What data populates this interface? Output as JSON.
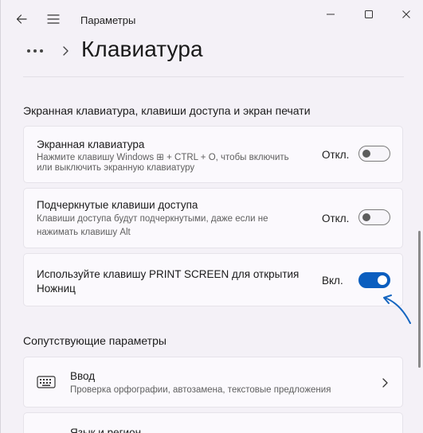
{
  "titlebar": {
    "app_title": "Параметры",
    "icons": [
      "back-arrow-icon",
      "hamburger-menu-icon",
      "minimize-icon",
      "maximize-icon",
      "close-icon"
    ]
  },
  "header": {
    "breadcrumb_more": "•••",
    "page_title": "Клавиатура"
  },
  "section1": {
    "title": "Экранная клавиатура, клавиши доступа и экран печати",
    "cards": [
      {
        "title": "Экранная клавиатура",
        "subtitle_line1": "Нажмите клавишу Windows ⊞ + CTRL + O, чтобы включить",
        "subtitle_line2": "или выключить экранную клавиатуру",
        "state": "Откл.",
        "on": false
      },
      {
        "title": "Подчеркнутые клавиши доступа",
        "subtitle_line1": "Клавиши доступа будут подчеркнутыми, даже если не",
        "subtitle_line2": "нажимать клавишу Alt",
        "state": "Откл.",
        "on": false
      },
      {
        "title_line1": "Используйте клавишу PRINT SCREEN для открытия",
        "title_line2": "Ножниц",
        "state": "Вкл.",
        "on": true
      }
    ]
  },
  "section2": {
    "title": "Сопутствующие параметры",
    "items": [
      {
        "icon": "keyboard-icon",
        "title": "Ввод",
        "subtitle": "Проверка орфографии, автозамена, текстовые предложения"
      },
      {
        "title": "Язык и регион"
      }
    ]
  },
  "colors": {
    "accent": "#0a5ebf",
    "annotation_arrow": "#1565c0",
    "background": "#f4f1f7",
    "card": "#fbf9fd"
  }
}
